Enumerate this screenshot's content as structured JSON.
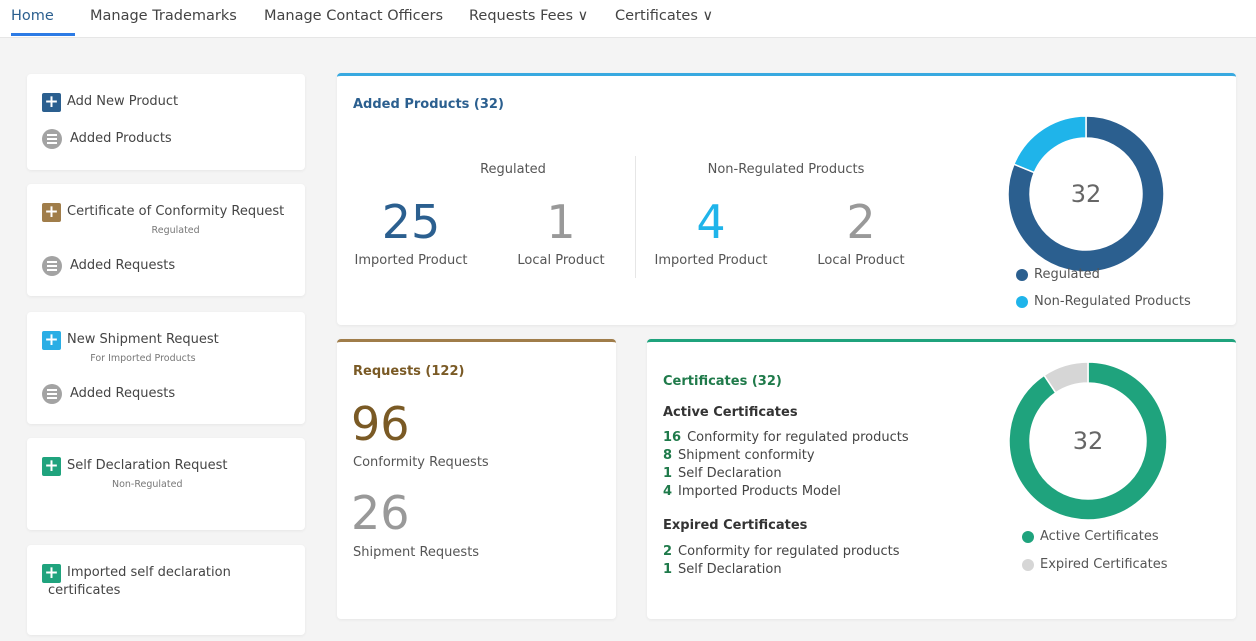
{
  "nav": {
    "items": [
      {
        "label": "Home"
      },
      {
        "label": "Manage Trademarks"
      },
      {
        "label": "Manage Contact Officers"
      },
      {
        "label": "Requests Fees ∨"
      },
      {
        "label": "Certificates ∨"
      }
    ]
  },
  "sidebar": {
    "products": {
      "add": "Add New Product",
      "list": "Added Products"
    },
    "conformity": {
      "add": "Certificate of Conformity Request",
      "sub": "Regulated",
      "list": "Added Requests"
    },
    "shipment": {
      "add": "New Shipment Request",
      "sub": "For Imported Products",
      "list": "Added Requests"
    },
    "self_decl": {
      "add": "Self Declaration Request",
      "sub": "Non-Regulated"
    },
    "imported_self": {
      "add_line1": "Imported self declaration",
      "add_line2": "certificates"
    }
  },
  "products": {
    "title": "Added Products (32)",
    "regulated": {
      "label": "Regulated",
      "imported": "25",
      "imported_label": "Imported Product",
      "local": "1",
      "local_label": "Local Product"
    },
    "non_regulated": {
      "label": "Non-Regulated Products",
      "imported": "4",
      "imported_label": "Imported Product",
      "local": "2",
      "local_label": "Local Product"
    },
    "donut_center": "32",
    "legend": [
      "Regulated",
      "Non-Regulated Products"
    ]
  },
  "requests": {
    "title": "Requests (122)",
    "conformity_count": "96",
    "conformity_label": "Conformity Requests",
    "shipment_count": "26",
    "shipment_label": "Shipment Requests"
  },
  "certificates": {
    "title": "Certificates (32)",
    "active_heading": "Active Certificates",
    "active": [
      {
        "count": "16",
        "label": "Conformity for regulated products"
      },
      {
        "count": "8",
        "label": "Shipment conformity"
      },
      {
        "count": "1",
        "label": "Self Declaration"
      },
      {
        "count": "4",
        "label": "Imported Products Model"
      }
    ],
    "expired_heading": "Expired Certificates",
    "expired": [
      {
        "count": "2",
        "label": "Conformity for regulated products"
      },
      {
        "count": "1",
        "label": "Self Declaration"
      }
    ],
    "donut_center": "32",
    "legend": [
      "Active Certificates",
      "Expired Certificates"
    ]
  },
  "chart_data": [
    {
      "type": "pie",
      "categories": [
        "Regulated",
        "Non-Regulated Products"
      ],
      "values": [
        26,
        6
      ],
      "colors": [
        "#2b5f8f",
        "#1fb4ea"
      ]
    },
    {
      "type": "pie",
      "categories": [
        "Active Certificates",
        "Expired Certificates"
      ],
      "values": [
        29,
        3
      ],
      "colors": [
        "#1fa37d",
        "#d6d6d6"
      ]
    }
  ]
}
